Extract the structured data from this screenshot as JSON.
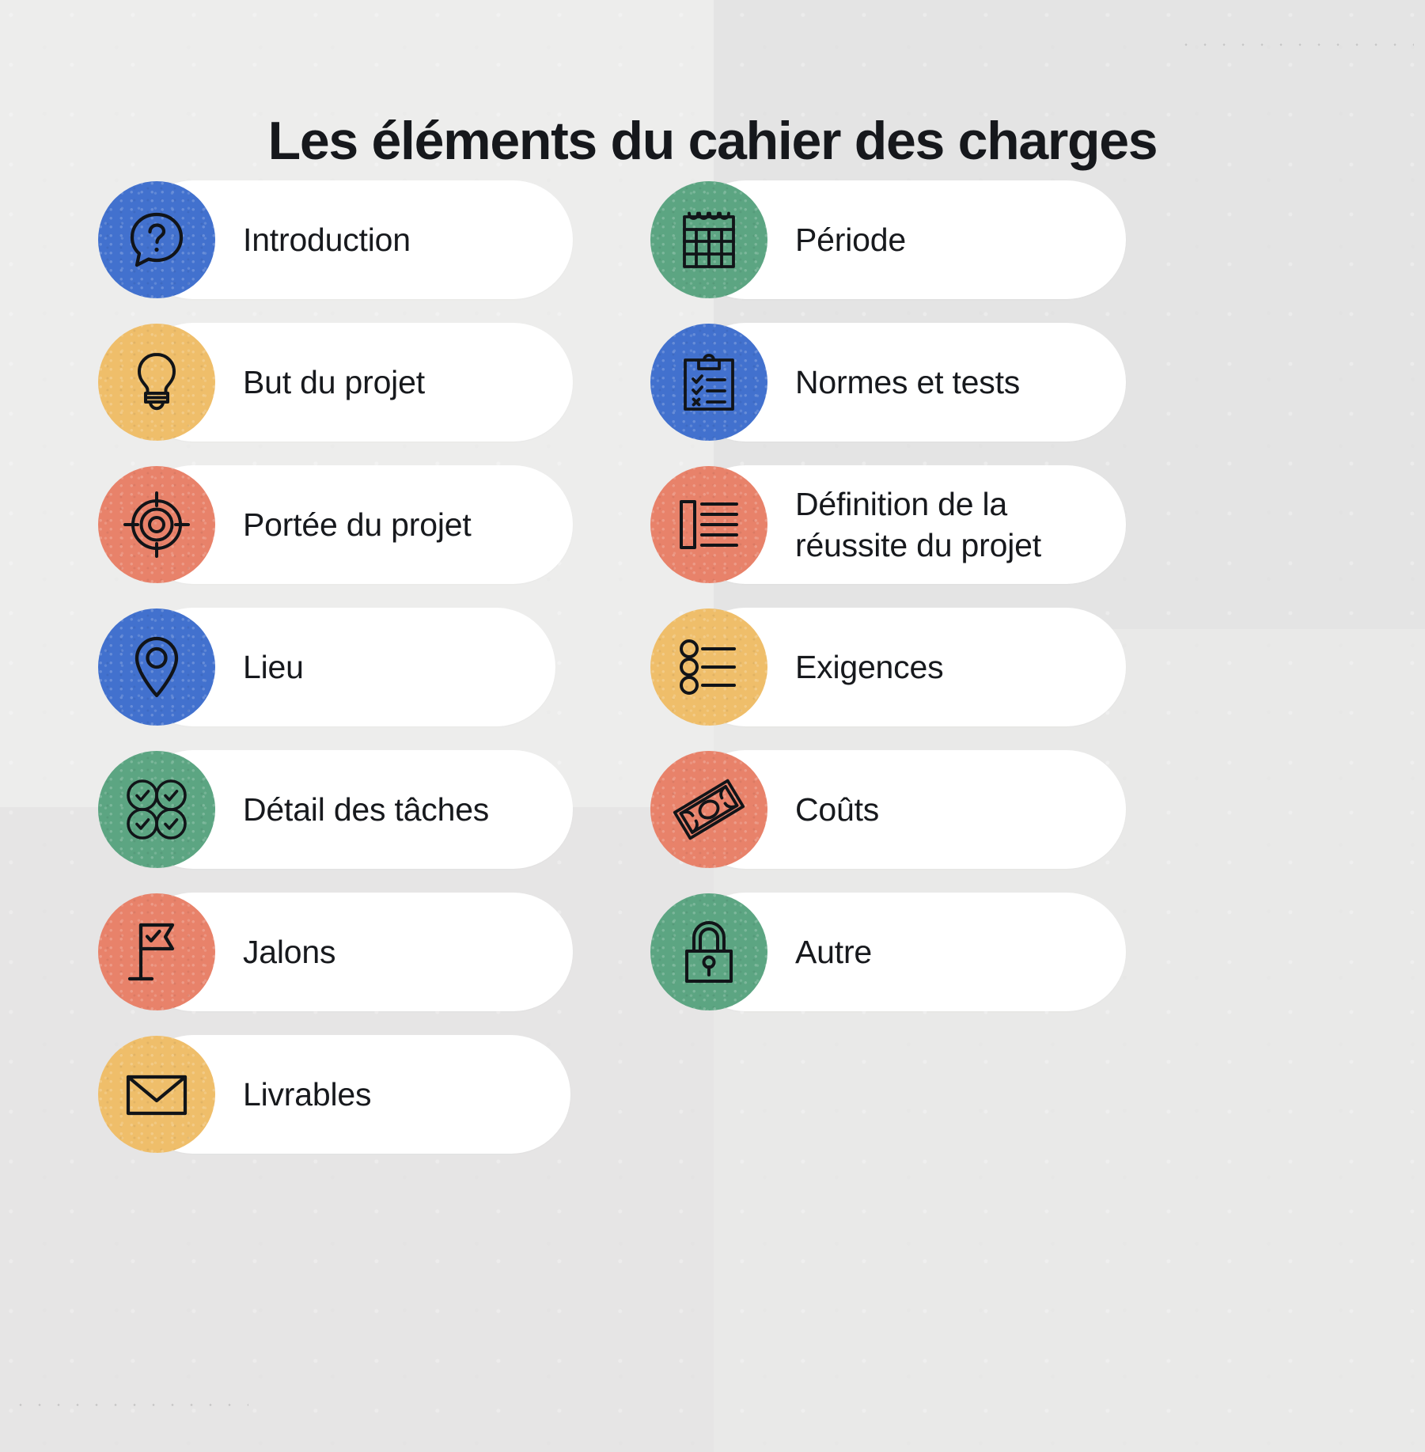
{
  "title": "Les éléments du cahier des charges",
  "colors": {
    "blue": "#4271ce",
    "yellow": "#efbe6a",
    "coral": "#e8826a",
    "green": "#5ca582",
    "background": "#e9e9e9",
    "card": "#ffffff",
    "text": "#17191d"
  },
  "columns": {
    "left": {
      "items": [
        {
          "label": "Introduction",
          "icon": "question-speech-bubble-icon",
          "color": "#4271ce"
        },
        {
          "label": "But du projet",
          "icon": "lightbulb-icon",
          "color": "#efbe6a"
        },
        {
          "label": "Portée du projet",
          "icon": "target-icon",
          "color": "#e8826a"
        },
        {
          "label": "Lieu",
          "icon": "map-pin-icon",
          "color": "#4271ce"
        },
        {
          "label": "Détail des tâches",
          "icon": "four-checks-icon",
          "color": "#5ca582"
        },
        {
          "label": "Jalons",
          "icon": "flag-check-icon",
          "color": "#e8826a"
        },
        {
          "label": "Livrables",
          "icon": "envelope-icon",
          "color": "#efbe6a"
        }
      ]
    },
    "right": {
      "items": [
        {
          "label": "Période",
          "icon": "calendar-icon",
          "color": "#5ca582"
        },
        {
          "label": "Normes et tests",
          "icon": "clipboard-check-icon",
          "color": "#4271ce"
        },
        {
          "label": "Définition de la réussite du projet",
          "icon": "document-lines-icon",
          "color": "#e8826a"
        },
        {
          "label": "Exigences",
          "icon": "bullet-list-icon",
          "color": "#efbe6a"
        },
        {
          "label": "Coûts",
          "icon": "banknote-icon",
          "color": "#e8826a"
        },
        {
          "label": "Autre",
          "icon": "padlock-icon",
          "color": "#5ca582"
        }
      ]
    }
  },
  "decorations": {
    "dotted_line_top_right": "dotted-line",
    "dotted_line_bottom_left": "dotted-line"
  }
}
